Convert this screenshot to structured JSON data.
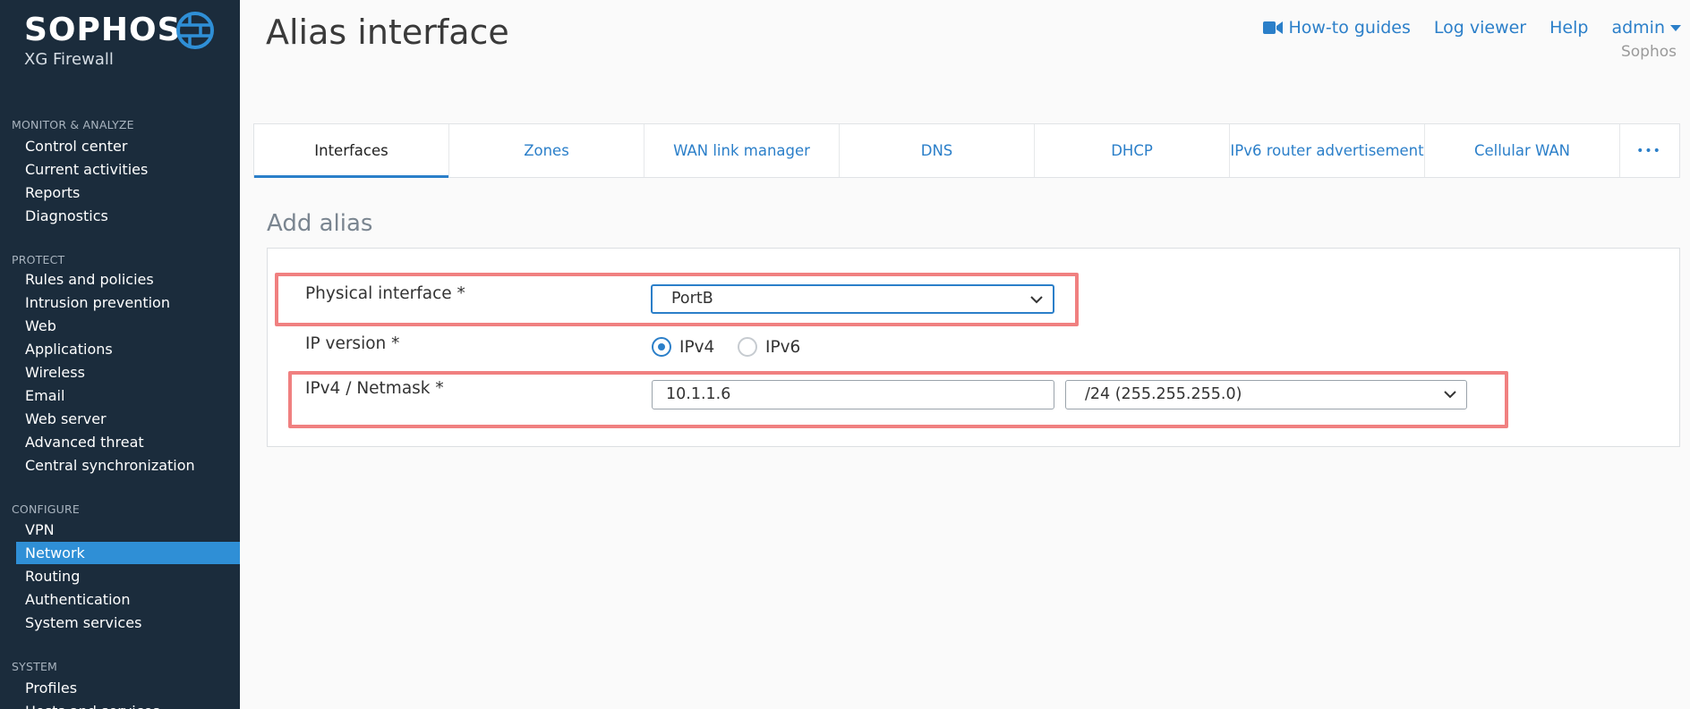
{
  "brand": {
    "name": "SOPHOS",
    "product": "XG Firewall"
  },
  "sidebar": {
    "sections": [
      {
        "heading": "MONITOR & ANALYZE",
        "items": [
          "Control center",
          "Current activities",
          "Reports",
          "Diagnostics"
        ]
      },
      {
        "heading": "PROTECT",
        "items": [
          "Rules and policies",
          "Intrusion prevention",
          "Web",
          "Applications",
          "Wireless",
          "Email",
          "Web server",
          "Advanced threat",
          "Central synchronization"
        ]
      },
      {
        "heading": "CONFIGURE",
        "items": [
          "VPN",
          "Network",
          "Routing",
          "Authentication",
          "System services"
        ]
      },
      {
        "heading": "SYSTEM",
        "items": [
          "Profiles",
          "Hosts and services"
        ]
      }
    ],
    "active_item": "Network"
  },
  "header": {
    "title": "Alias interface",
    "links": {
      "howto": "How-to guides",
      "log_viewer": "Log viewer",
      "help": "Help",
      "user": "admin"
    },
    "company": "Sophos"
  },
  "tabs": [
    "Interfaces",
    "Zones",
    "WAN link manager",
    "DNS",
    "DHCP",
    "IPv6 router advertisement",
    "Cellular WAN"
  ],
  "active_tab": "Interfaces",
  "more_tabs_label": "•••",
  "form": {
    "section_title": "Add alias",
    "physical_interface": {
      "label": "Physical interface *",
      "value": "PortB"
    },
    "ip_version": {
      "label": "IP version *",
      "options": [
        "IPv4",
        "IPv6"
      ],
      "selected": "IPv4"
    },
    "ipv4_netmask": {
      "label": "IPv4 / Netmask *",
      "ip_value": "10.1.1.6",
      "netmask_value": "/24 (255.255.255.0)"
    }
  },
  "colors": {
    "sidebar_bg": "#1b2c3c",
    "accent": "#2b7fc9",
    "highlight": "#f08080"
  },
  "icons": {
    "howto": "video-camera-icon",
    "logo": "globe-icon",
    "dropdown": "chevron-down-icon",
    "more": "ellipsis-icon"
  }
}
